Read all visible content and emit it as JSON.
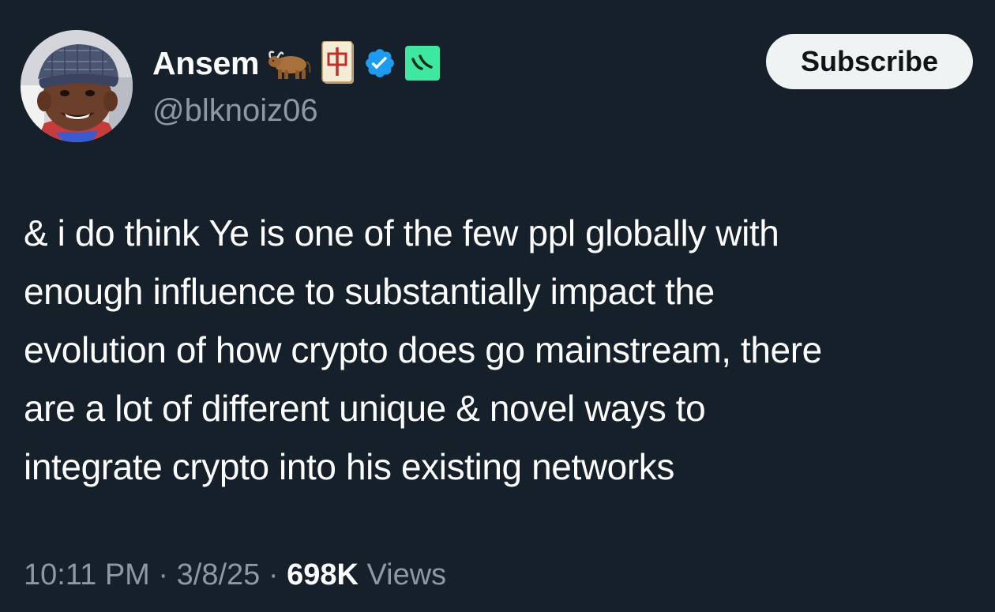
{
  "author": {
    "display_name": "Ansem",
    "handle": "@blknoiz06",
    "badges": [
      "ox-emoji",
      "mahjong-red-dragon-emoji",
      "verified-badge-icon",
      "affiliate-badge-icon"
    ]
  },
  "actions": {
    "subscribe_label": "Subscribe"
  },
  "tweet": {
    "text": "& i do think Ye is one of the few ppl globally with\nenough influence to substantially impact the\nevolution of how crypto does go mainstream, there\nare a lot of different unique & novel ways to\nintegrate crypto into his existing networks"
  },
  "meta": {
    "time": "10:11 PM",
    "separator": " · ",
    "date": "3/8/25",
    "views_count": "698K",
    "views_label": " Views"
  },
  "colors": {
    "background": "#15202b",
    "text_primary": "#ffffff",
    "text_secondary": "#8b98a5",
    "verified_blue": "#1d9bf0",
    "affiliate_green": "#3ee8a0",
    "button_bg": "#eff3f4"
  }
}
